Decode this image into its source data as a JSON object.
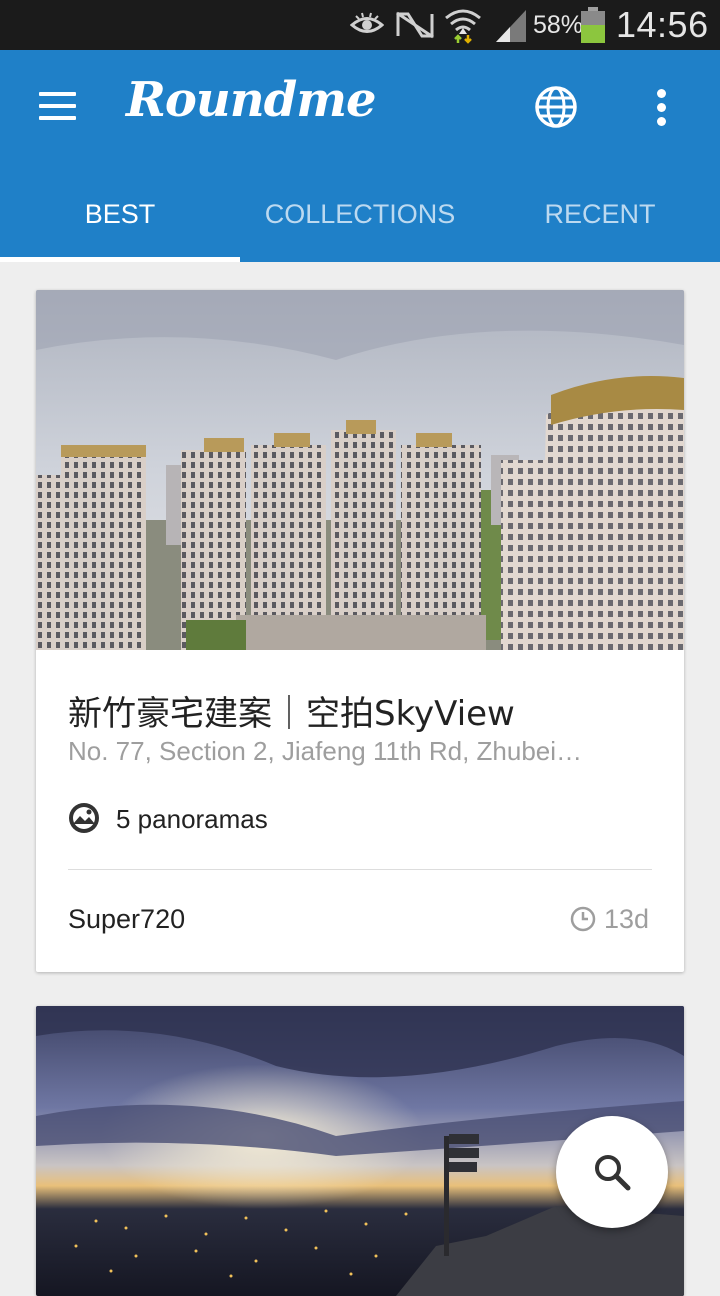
{
  "status_bar": {
    "battery_percent": "58%",
    "time": "14:56",
    "icons": [
      "eye-icon",
      "nfc-mute-icon",
      "wifi-icon",
      "signal-icon",
      "battery-icon"
    ]
  },
  "app_bar": {
    "brand": "Roundme",
    "icons": {
      "menu": "hamburger-menu-icon",
      "globe": "globe-icon",
      "more": "more-vert-icon"
    }
  },
  "tabs": [
    {
      "label": "BEST",
      "active": true
    },
    {
      "label": "COLLECTIONS",
      "active": false
    },
    {
      "label": "RECENT",
      "active": false
    }
  ],
  "cards": [
    {
      "title": "新竹豪宅建案｜空拍SkyView",
      "address": "No. 77, Section 2, Jiafeng 11th Rd, Zhubei…",
      "panoramas": "5 panoramas",
      "author": "Super720",
      "time_ago": "13d",
      "image": "high-rise residential towers panorama"
    },
    {
      "image": "city lights at dusk panorama from mountain"
    }
  ],
  "fab": {
    "icon": "search-icon"
  },
  "colors": {
    "app_bar": "#1f80c8",
    "status_bar": "#1b1b1b",
    "background": "#eeeeee",
    "tab_inactive": "#bcd9f0"
  }
}
